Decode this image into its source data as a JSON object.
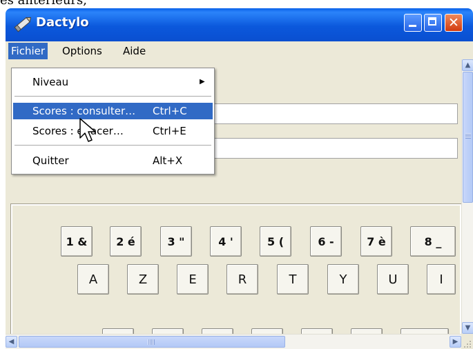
{
  "page_fragment": "es antérieurs,",
  "window": {
    "title": "Dactylo",
    "close_glyph": "✕"
  },
  "menubar": {
    "items": [
      {
        "label": "Fichier"
      },
      {
        "label": "Options"
      },
      {
        "label": "Aide"
      }
    ]
  },
  "dropdown": {
    "items": [
      {
        "label": "Niveau",
        "shortcut": "",
        "submenu_arrow": "▶"
      },
      {
        "label": "Scores : consulter…",
        "shortcut": "Ctrl+C",
        "highlighted": true
      },
      {
        "label": "Scores : effacer…",
        "shortcut": "Ctrl+E"
      },
      {
        "label": "Quitter",
        "shortcut": "Alt+X"
      }
    ]
  },
  "keyboard": {
    "row1": [
      "1 &",
      "2 é",
      "3 \"",
      "4 '",
      "5 (",
      "6 -",
      "7 è",
      "8 _"
    ],
    "row2": [
      "A",
      "Z",
      "E",
      "R",
      "T",
      "Y",
      "U",
      "I"
    ]
  },
  "scrollbar": {
    "up": "▲",
    "down": "▼",
    "left": "◀",
    "right": "▶"
  },
  "colors": {
    "titlebar": "#0b58dc",
    "menu_highlight": "#316ac5",
    "window_bg": "#ece9d8"
  },
  "icons": {
    "app": "pencil-icon",
    "cursor": "mouse-pointer-icon"
  }
}
